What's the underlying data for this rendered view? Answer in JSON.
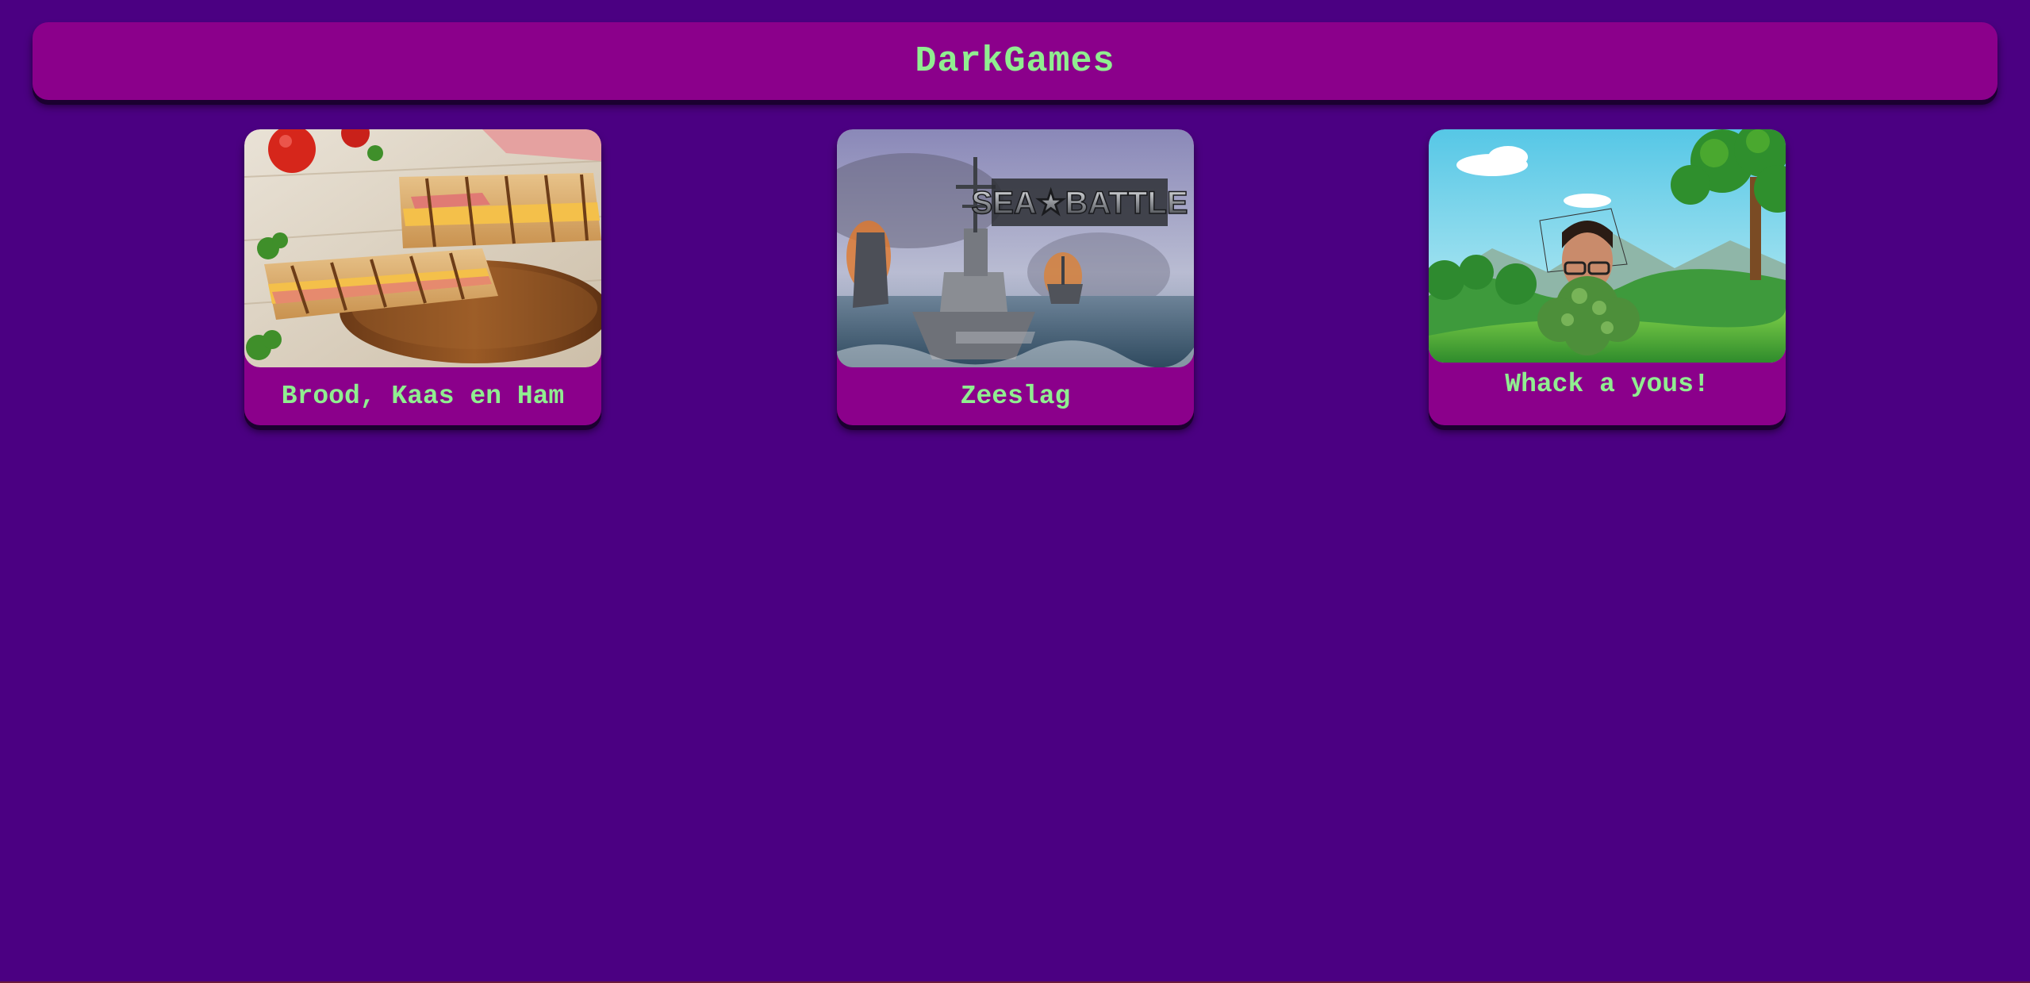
{
  "header": {
    "title": "DarkGames"
  },
  "games": [
    {
      "title": "Brood, Kaas en Ham",
      "image": "toasted-sandwich-image"
    },
    {
      "title": "Zeeslag",
      "image": "sea-battle-image",
      "image_text": "SEA★BATTLE"
    },
    {
      "title": "Whack a yous!",
      "image": "whack-a-mole-scene-image"
    }
  ],
  "colors": {
    "background": "#4b0082",
    "panel": "#8b008b",
    "text": "#90ee90"
  }
}
